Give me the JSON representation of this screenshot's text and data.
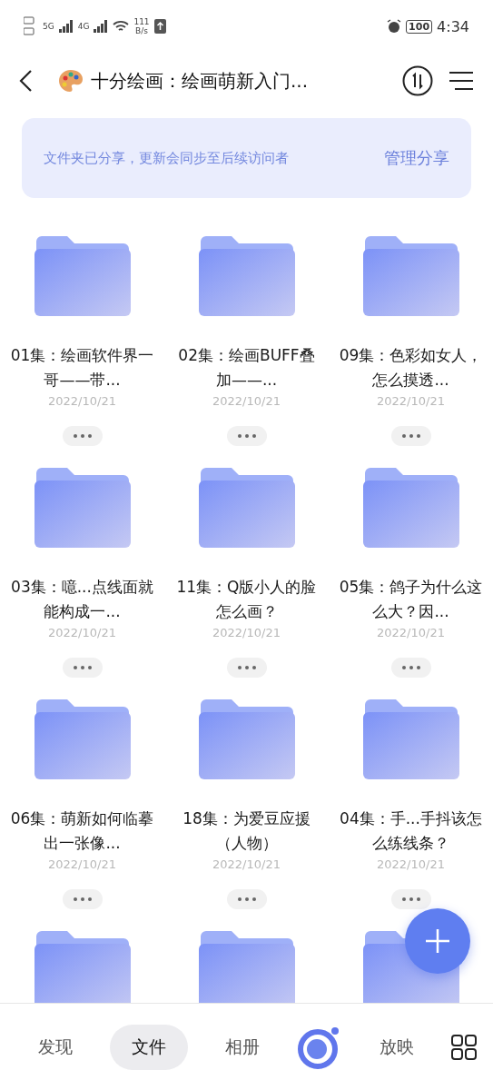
{
  "status_bar": {
    "net_5g": "5G",
    "net_4g": "4G",
    "speed_value": "111",
    "speed_unit": "B/s",
    "battery": "100",
    "time": "4:34"
  },
  "header": {
    "title": "十分绘画：绘画萌新入门..."
  },
  "banner": {
    "message": "文件夹已分享，更新会同步至后续访问者",
    "action": "管理分享"
  },
  "folders": [
    {
      "kind": "folder",
      "title": "01集：绘画软件界一哥——带...",
      "date": "2022/10/21"
    },
    {
      "kind": "folder",
      "title": "02集：绘画BUFF叠加——...",
      "date": "2022/10/21"
    },
    {
      "kind": "folder",
      "title": "09集：色彩如女人，怎么摸透...",
      "date": "2022/10/21"
    },
    {
      "kind": "folder",
      "title": "03集：噫...点线面就能构成一...",
      "date": "2022/10/21"
    },
    {
      "kind": "folder",
      "title": "11集：Q版小人的脸怎么画？",
      "date": "2022/10/21"
    },
    {
      "kind": "folder",
      "title": "05集：鸽子为什么这么大？因...",
      "date": "2022/10/21"
    },
    {
      "kind": "folder",
      "title": "06集：萌新如何临摹出一张像...",
      "date": "2022/10/21"
    },
    {
      "kind": "folder",
      "title": "18集：为爱豆应援（人物）",
      "date": "2022/10/21"
    },
    {
      "kind": "folder",
      "title": "04集：手...手抖该怎么练线条？",
      "date": "2022/10/21"
    },
    {
      "kind": "peek"
    },
    {
      "kind": "peek"
    },
    {
      "kind": "peek"
    }
  ],
  "nav": [
    {
      "kind": "tab",
      "label": "发现",
      "selected": false
    },
    {
      "kind": "tab",
      "label": "文件",
      "selected": true
    },
    {
      "kind": "tab",
      "label": "相册",
      "selected": false
    },
    {
      "kind": "logo"
    },
    {
      "kind": "tab",
      "label": "放映",
      "selected": false
    },
    {
      "kind": "grid"
    }
  ]
}
